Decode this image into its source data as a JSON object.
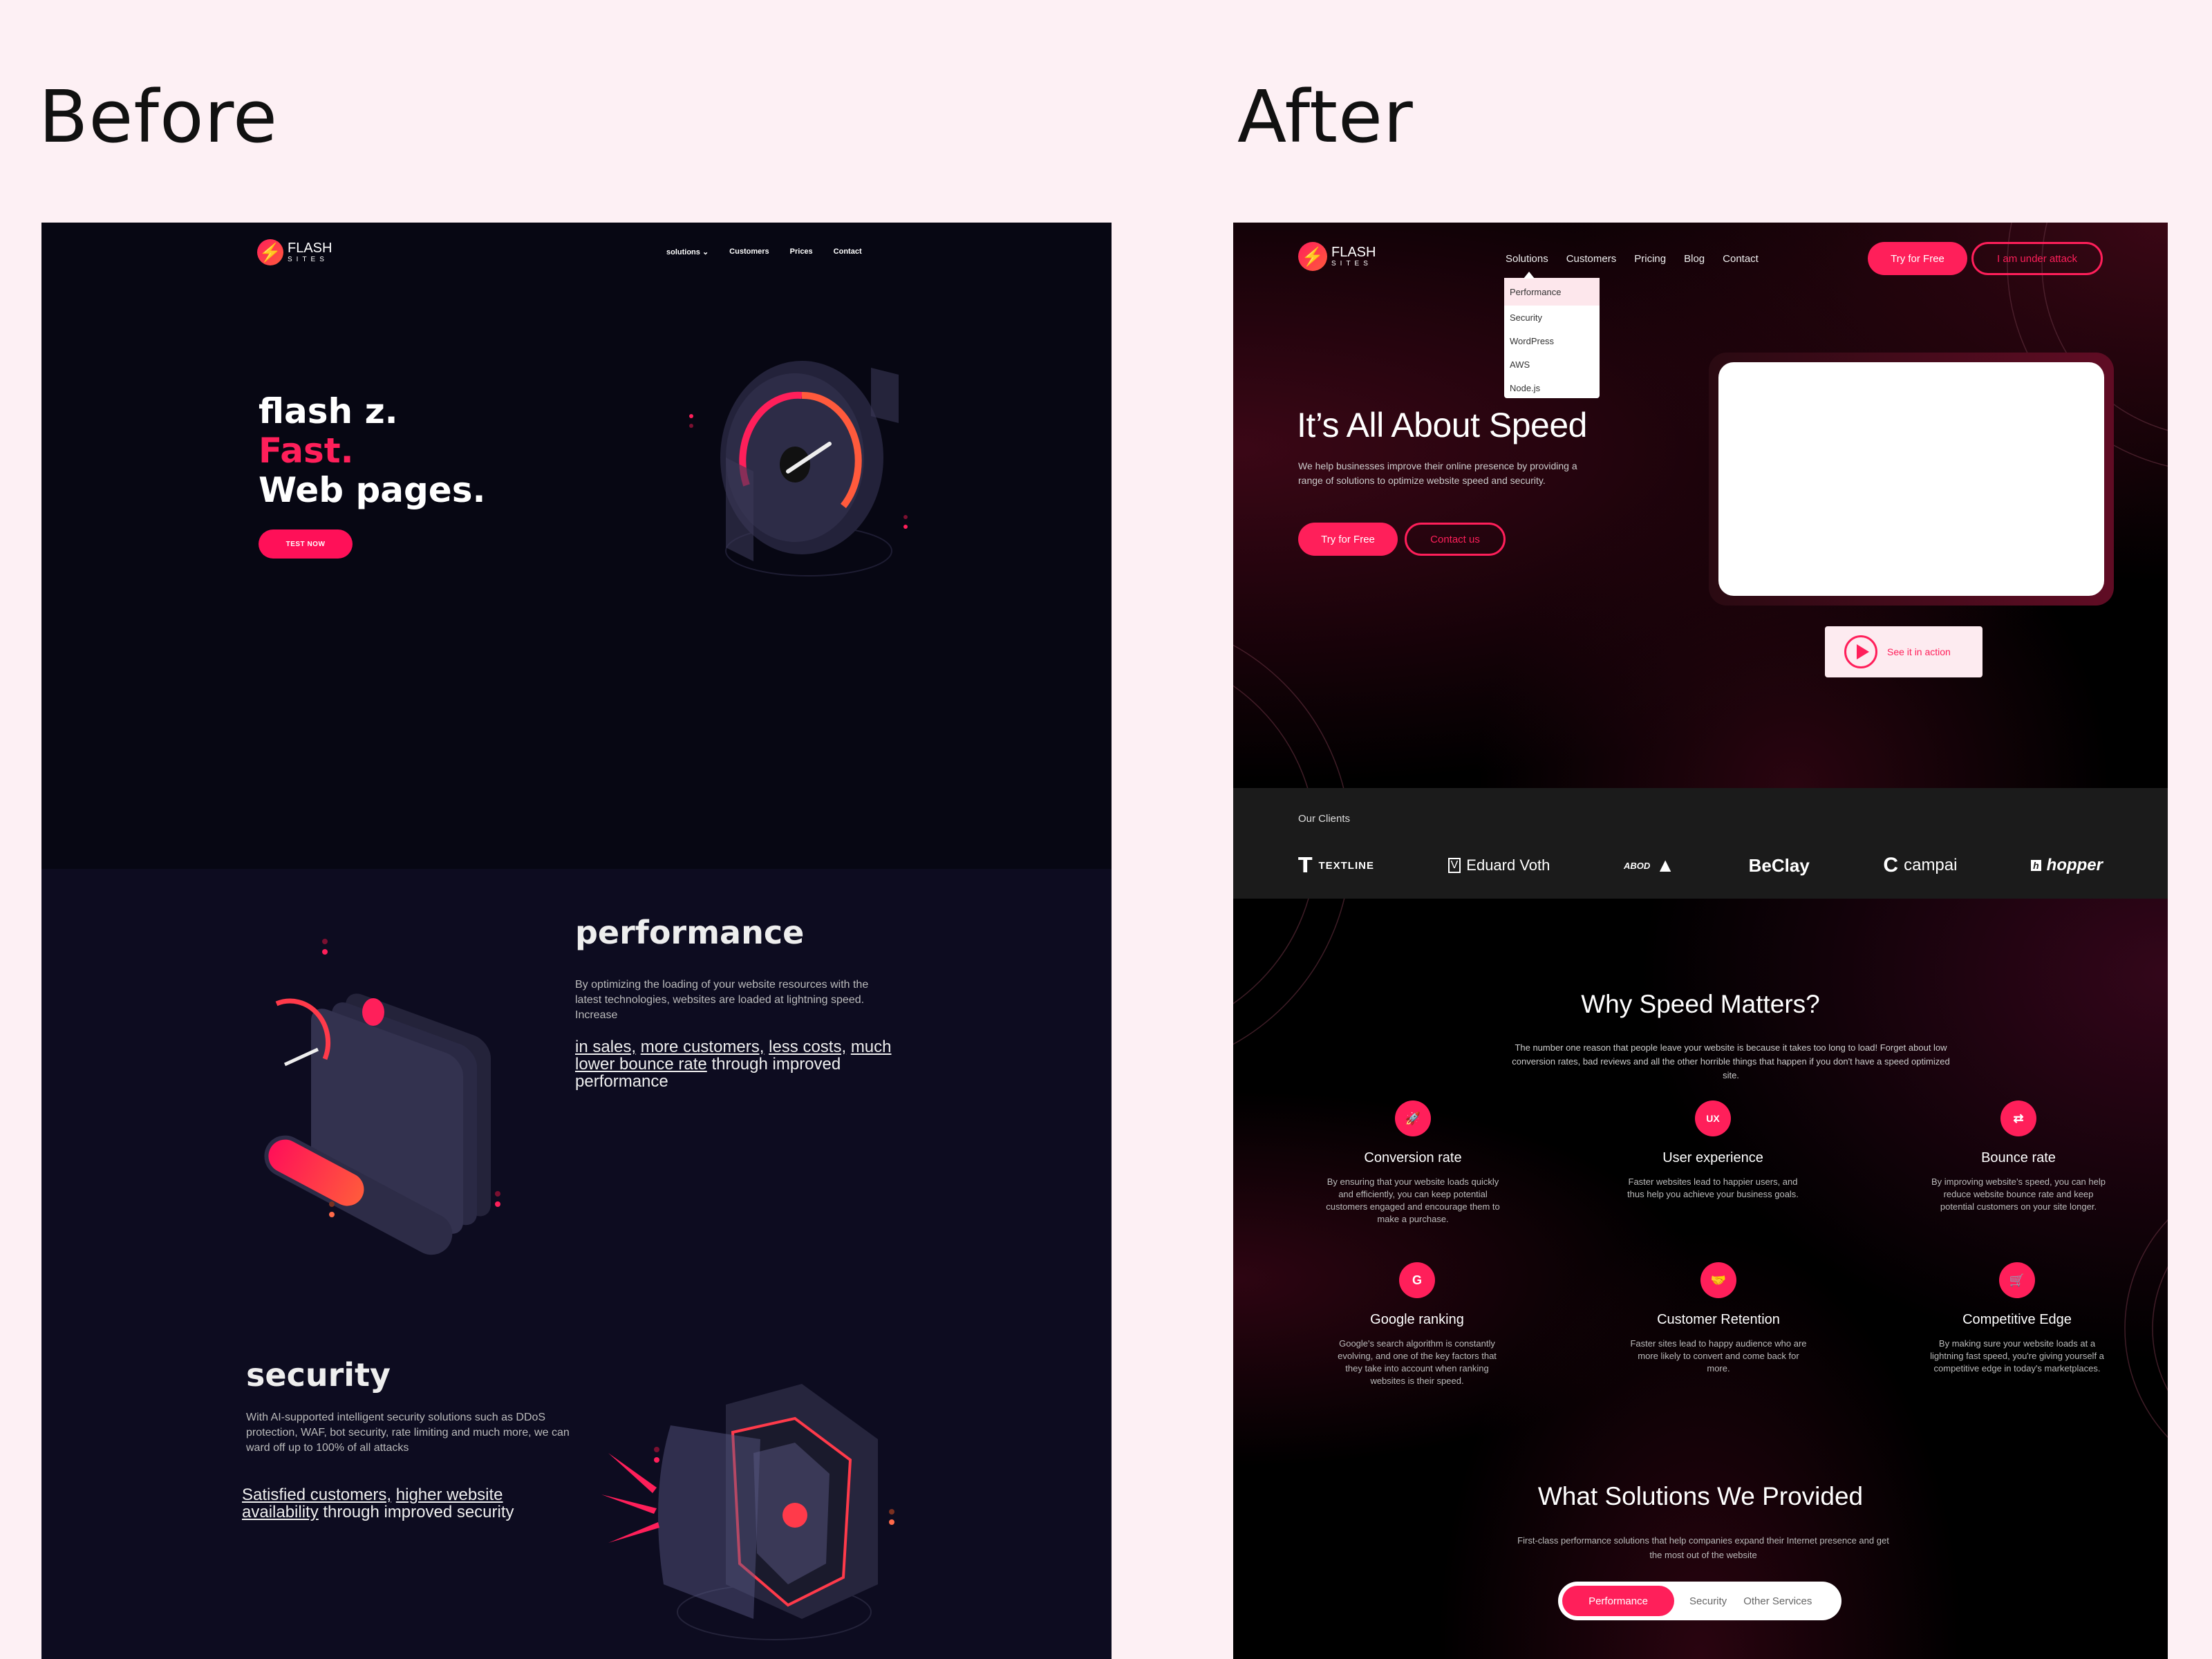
{
  "labels": {
    "before": "Before",
    "after": "After"
  },
  "colors": {
    "accent": "#ff1f5a",
    "before_bg": "#070713",
    "before_bg2": "#0d0c20",
    "after_bg": "#000000",
    "page_bg": "#fdf0f4"
  },
  "before": {
    "logo": {
      "line1": "FLASH",
      "line2": "SITES",
      "icon": "lightning-bolt-icon"
    },
    "nav": [
      "solutions ⌄",
      "Customers",
      "Prices",
      "Contact"
    ],
    "hero": {
      "line1": "flash z.",
      "line2": "Fast.",
      "line3": "Web pages.",
      "cta": "TEST NOW"
    },
    "performance": {
      "title": "performance",
      "body": "By optimizing the loading of your website resources with the latest technologies, websites are loaded at lightning speed. Increase",
      "links": [
        "in sales,",
        "more customers,",
        "less costs,",
        "much lower bounce rate"
      ],
      "tail": "through improved performance"
    },
    "security": {
      "title": "security",
      "body": "With AI-supported intelligent security solutions such as DDoS protection, WAF, bot security, rate limiting and much more, we can ward off up to 100% of all attacks",
      "links": [
        "Satisfied customers,",
        "higher website availability"
      ],
      "tail": "through improved security"
    }
  },
  "after": {
    "logo": {
      "line1": "FLASH",
      "line2": "SITES",
      "icon": "lightning-bolt-icon"
    },
    "nav": [
      "Solutions",
      "Customers",
      "Pricing",
      "Blog",
      "Contact"
    ],
    "dropdown": [
      "Performance",
      "Security",
      "WordPress",
      "AWS",
      "Node.js"
    ],
    "dropdown_active": "Performance",
    "header_buttons": {
      "try": "Try for Free",
      "attack": "I am under attack"
    },
    "hero": {
      "title": "It’s All About Speed",
      "description": "We help businesses improve their online presence by providing a range of solutions to optimize website speed and security.",
      "try": "Try for Free",
      "contact": "Contact us",
      "see_action": "See it in action"
    },
    "clients": {
      "label": "Our Clients",
      "logos": [
        "TEXTLINE",
        "Eduard Voth",
        "ABOD",
        "BeClay",
        "campai",
        "hopper"
      ]
    },
    "why": {
      "title": "Why Speed Matters?",
      "description": "The number one reason that people leave your website is because it takes too long to load! Forget about low conversion rates, bad reviews and all the other horrible things that happen if you don't have a speed optimized site.",
      "features": [
        {
          "icon": "rocket-icon",
          "glyph": "🚀",
          "title": "Conversion rate",
          "text": "By ensuring that your website loads quickly and efficiently, you can keep potential customers engaged and encourage them to make a purchase."
        },
        {
          "icon": "ux-icon",
          "glyph": "UX",
          "title": "User experience",
          "text": "Faster websites lead to happier users, and thus help you achieve your business goals."
        },
        {
          "icon": "bounce-arrows-icon",
          "glyph": "⇄",
          "title": "Bounce rate",
          "text": "By improving website’s speed, you can help reduce website bounce rate and keep potential customers on your site longer."
        },
        {
          "icon": "google-icon",
          "glyph": "G",
          "title": "Google ranking",
          "text": "Google's search algorithm is constantly evolving, and one of the key factors that they take into account when ranking websites is their speed."
        },
        {
          "icon": "handshake-icon",
          "glyph": "🤝",
          "title": "Customer Retention",
          "text": "Faster sites lead to happy audience who are more likely to convert and come back for more."
        },
        {
          "icon": "cart-icon",
          "glyph": "🛒",
          "title": "Competitive Edge",
          "text": "By making sure your website loads at a lightning fast speed, you're giving yourself a competitive edge in today's marketplaces."
        }
      ]
    },
    "solutions": {
      "title": "What Solutions We Provided",
      "description": "First-class performance solutions that help companies expand their Internet presence and get the most out of the website",
      "tabs": [
        "Performance",
        "Security",
        "Other Services"
      ],
      "active_tab": "Performance"
    }
  }
}
